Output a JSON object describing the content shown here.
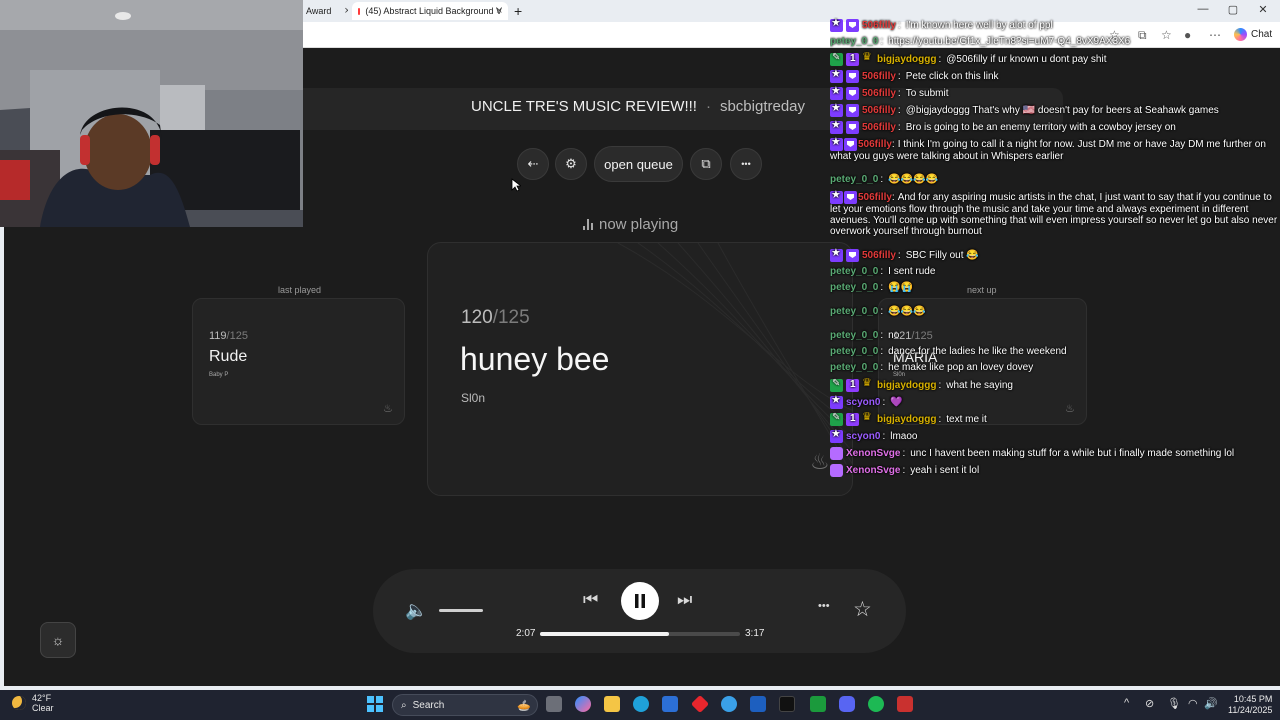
{
  "browser": {
    "tabs": [
      {
        "label": "Award"
      },
      {
        "label": "(45) Abstract Liquid Background V"
      }
    ],
    "new_tab": "+",
    "chat_button": "Chat",
    "window_controls": {
      "minimize": "—",
      "maximize": "▢",
      "close": "✕"
    }
  },
  "app": {
    "title": "UNCLE TRE'S MUSIC REVIEW!!!",
    "channel": "sbcbigtreday",
    "title_separator": "·",
    "controls": {
      "open_queue": "open queue"
    },
    "now_playing_label": "now playing",
    "last_played_label": "last played",
    "next_up_label": "next up",
    "last_played": {
      "number": "119",
      "total": "/125",
      "title": "Rude",
      "artist": "Baby P"
    },
    "current": {
      "number": "120",
      "total": "/125",
      "title": "huney bee",
      "artist": "Sl0n"
    },
    "next_up": {
      "number": "121",
      "total": "/125",
      "title": "MARIA",
      "artist": "Sl0n"
    },
    "player": {
      "elapsed": "2:07",
      "duration": "3:17",
      "progress": 0.645,
      "volume": 0.55
    }
  },
  "chat": {
    "messages": [
      {
        "user": "506filly",
        "color": "#e23a3a",
        "badges": [
          "star",
          "vip"
        ],
        "text": "I'm known here well by alot of ppl"
      },
      {
        "user": "petey_0_0",
        "color": "#5aaa74",
        "badges": [],
        "text": "https://youtu.be/Gf1x_JleTn8?si=uM7-Q4_8vX9AX3X6"
      },
      {
        "user": "bigjaydoggg",
        "color": "#d9b200",
        "badges": [
          "mod",
          "sub",
          "crown"
        ],
        "text": "@506filly if ur known u dont pay shit"
      },
      {
        "user": "506filly",
        "color": "#e23a3a",
        "badges": [
          "star",
          "vip"
        ],
        "text": "Pete click on this link"
      },
      {
        "user": "506filly",
        "color": "#e23a3a",
        "badges": [
          "star",
          "vip"
        ],
        "text": "To submit"
      },
      {
        "user": "506filly",
        "color": "#e23a3a",
        "badges": [
          "star",
          "vip"
        ],
        "text": "@bigjaydoggg That's why 🇺🇸 doesn't pay for beers at Seahawk games"
      },
      {
        "user": "506filly",
        "color": "#e23a3a",
        "badges": [
          "star",
          "vip"
        ],
        "text": "Bro is going to be an enemy territory with a cowboy jersey on"
      },
      {
        "user": "506filly",
        "color": "#e23a3a",
        "badges": [
          "star",
          "vip"
        ],
        "text": "I think I'm going to call it a night for now. Just DM me or have Jay DM me further on what you guys were talking about in Whispers earlier"
      },
      {
        "user": "petey_0_0",
        "color": "#5aaa74",
        "badges": [],
        "text": "😂😂😂😂"
      },
      {
        "user": "506filly",
        "color": "#e23a3a",
        "badges": [
          "star",
          "vip"
        ],
        "text": "And for any aspiring music artists in the chat, I just want to say that if you continue to let your emotions flow through the music and take your time and always experiment in different avenues. You'll come up with something that will even impress yourself so never let go but also never overwork yourself through burnout"
      },
      {
        "user": "506filly",
        "color": "#e23a3a",
        "badges": [
          "star",
          "vip"
        ],
        "text": "SBC Filly out 😂"
      },
      {
        "user": "petey_0_0",
        "color": "#5aaa74",
        "badges": [],
        "text": "I sent rude"
      },
      {
        "user": "petey_0_0",
        "color": "#5aaa74",
        "badges": [],
        "text": "😭😭"
      },
      {
        "user": "petey_0_0",
        "color": "#5aaa74",
        "badges": [],
        "text": "😂😂😂"
      },
      {
        "user": "petey_0_0",
        "color": "#5aaa74",
        "badges": [],
        "text": "no"
      },
      {
        "user": "petey_0_0",
        "color": "#5aaa74",
        "badges": [],
        "text": "dance for the ladies he like the weekend"
      },
      {
        "user": "petey_0_0",
        "color": "#5aaa74",
        "badges": [],
        "text": "he make like pop an lovey dovey"
      },
      {
        "user": "bigjaydoggg",
        "color": "#d9b200",
        "badges": [
          "mod",
          "sub",
          "crown"
        ],
        "text": "what he saying"
      },
      {
        "user": "scyon0",
        "color": "#9b5cff",
        "badges": [
          "star"
        ],
        "text": "💜"
      },
      {
        "user": "bigjaydoggg",
        "color": "#d9b200",
        "badges": [
          "mod",
          "sub",
          "crown"
        ],
        "text": "text me it"
      },
      {
        "user": "scyon0",
        "color": "#9b5cff",
        "badges": [
          "star"
        ],
        "text": "lmaoo"
      },
      {
        "user": "XenonSvge",
        "color": "#e070e8",
        "badges": [
          "avatar"
        ],
        "text": "unc I havent been making stuff for a while but i finally made something lol"
      },
      {
        "user": "XenonSvge",
        "color": "#e070e8",
        "badges": [
          "avatar"
        ],
        "text": "yeah i sent it lol"
      }
    ]
  },
  "taskbar": {
    "weather_temp": "42°F",
    "weather_desc": "Clear",
    "search_placeholder": "Search",
    "time": "10:45 PM",
    "date": "11/24/2025"
  },
  "icons": {
    "exit": "⇠",
    "settings": "⚙",
    "share": "⧉",
    "more": "•••",
    "volume": "🔈",
    "prev": "⏮",
    "next": "⏭",
    "favorite": "☆",
    "theme": "☼"
  },
  "colors": {
    "background": "#1c1c1c",
    "card": "#232323",
    "accent": "#ffffff",
    "taskbar": "#1f2330"
  }
}
